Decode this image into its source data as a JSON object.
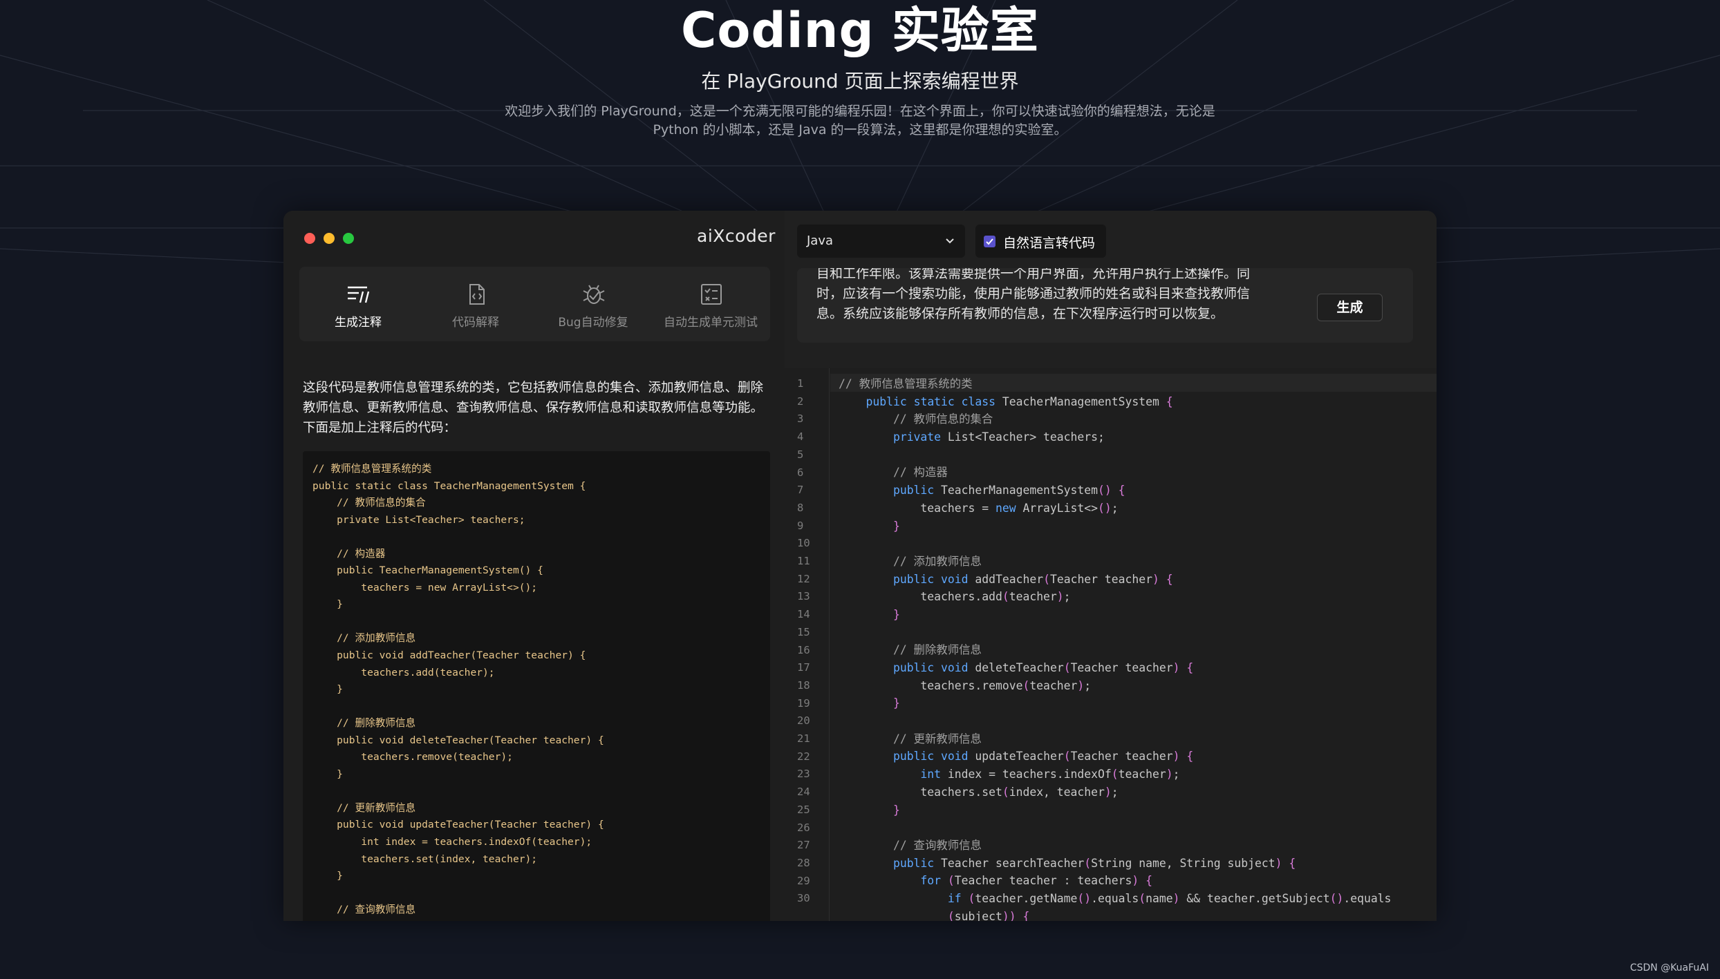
{
  "hero": {
    "title": "Coding 实验室",
    "subtitle": "在 PlayGround 页面上探索编程世界",
    "description_line1": "欢迎步入我们的 PlayGround，这是一个充满无限可能的编程乐园！在这个界面上，你可以快速试验你的编程想法，无论是",
    "description_line2": "Python 的小脚本，还是 Java 的一段算法，这里都是你理想的实验室。"
  },
  "window": {
    "logo": "aiXcoder",
    "dot_colors": [
      "#ff5f57",
      "#febc2e",
      "#28c840"
    ]
  },
  "tabs": [
    {
      "label": "生成注释",
      "icon": "generate-comment-icon",
      "active": true
    },
    {
      "label": "代码解释",
      "icon": "code-explain-icon",
      "active": false
    },
    {
      "label": "Bug自动修复",
      "icon": "bug-fix-icon",
      "active": false
    },
    {
      "label": "自动生成单元测试",
      "icon": "unit-test-icon",
      "active": false
    }
  ],
  "explanation": "这段代码是教师信息管理系统的类，它包括教师信息的集合、添加教师信息、删除教师信息、更新教师信息、查询教师信息、保存教师信息和读取教师信息等功能。下面是加上注释后的代码：",
  "left_code": [
    "// 教师信息管理系统的类",
    "public static class TeacherManagementSystem {",
    "    // 教师信息的集合",
    "    private List<Teacher> teachers;",
    "",
    "    // 构造器",
    "    public TeacherManagementSystem() {",
    "        teachers = new ArrayList<>();",
    "    }",
    "",
    "    // 添加教师信息",
    "    public void addTeacher(Teacher teacher) {",
    "        teachers.add(teacher);",
    "    }",
    "",
    "    // 删除教师信息",
    "    public void deleteTeacher(Teacher teacher) {",
    "        teachers.remove(teacher);",
    "    }",
    "",
    "    // 更新教师信息",
    "    public void updateTeacher(Teacher teacher) {",
    "        int index = teachers.indexOf(teacher);",
    "        teachers.set(index, teacher);",
    "    }",
    "",
    "    // 查询教师信息"
  ],
  "toolbar": {
    "language": "Java",
    "nl_toggle_label": "自然语言转代码",
    "nl_toggle_checked": true,
    "generate_label": "生成"
  },
  "prompt": {
    "line1": "目和工作年限。该算法需要提供一个用户界面，允许用户执行上述操作。同",
    "line2": "时，应该有一个搜索功能，使用户能够通过教师的姓名或科目来查找教师信",
    "line3": "息。系统应该能够保存所有教师的信息，在下次程序运行时可以恢复。"
  },
  "right_code": [
    "// 教师信息管理系统的类",
    "    public static class TeacherManagementSystem {",
    "        // 教师信息的集合",
    "        private List<Teacher> teachers;",
    "",
    "        // 构造器",
    "        public TeacherManagementSystem() {",
    "            teachers = new ArrayList<>();",
    "        }",
    "",
    "        // 添加教师信息",
    "        public void addTeacher(Teacher teacher) {",
    "            teachers.add(teacher);",
    "        }",
    "",
    "        // 删除教师信息",
    "        public void deleteTeacher(Teacher teacher) {",
    "            teachers.remove(teacher);",
    "        }",
    "",
    "        // 更新教师信息",
    "        public void updateTeacher(Teacher teacher) {",
    "            int index = teachers.indexOf(teacher);",
    "            teachers.set(index, teacher);",
    "        }",
    "",
    "        // 查询教师信息",
    "        public Teacher searchTeacher(String name, String subject) {",
    "            for (Teacher teacher : teachers) {",
    "                if (teacher.getName().equals(name) && teacher.getSubject().equals",
    "                (subject)) {"
  ],
  "line_numbers": [
    "1",
    "2",
    "3",
    "4",
    "5",
    "6",
    "7",
    "8",
    "9",
    "10",
    "11",
    "12",
    "13",
    "14",
    "15",
    "16",
    "17",
    "18",
    "19",
    "20",
    "21",
    "22",
    "23",
    "24",
    "25",
    "26",
    "27",
    "28",
    "29",
    "30"
  ],
  "watermark": "CSDN @KuaFuAI"
}
